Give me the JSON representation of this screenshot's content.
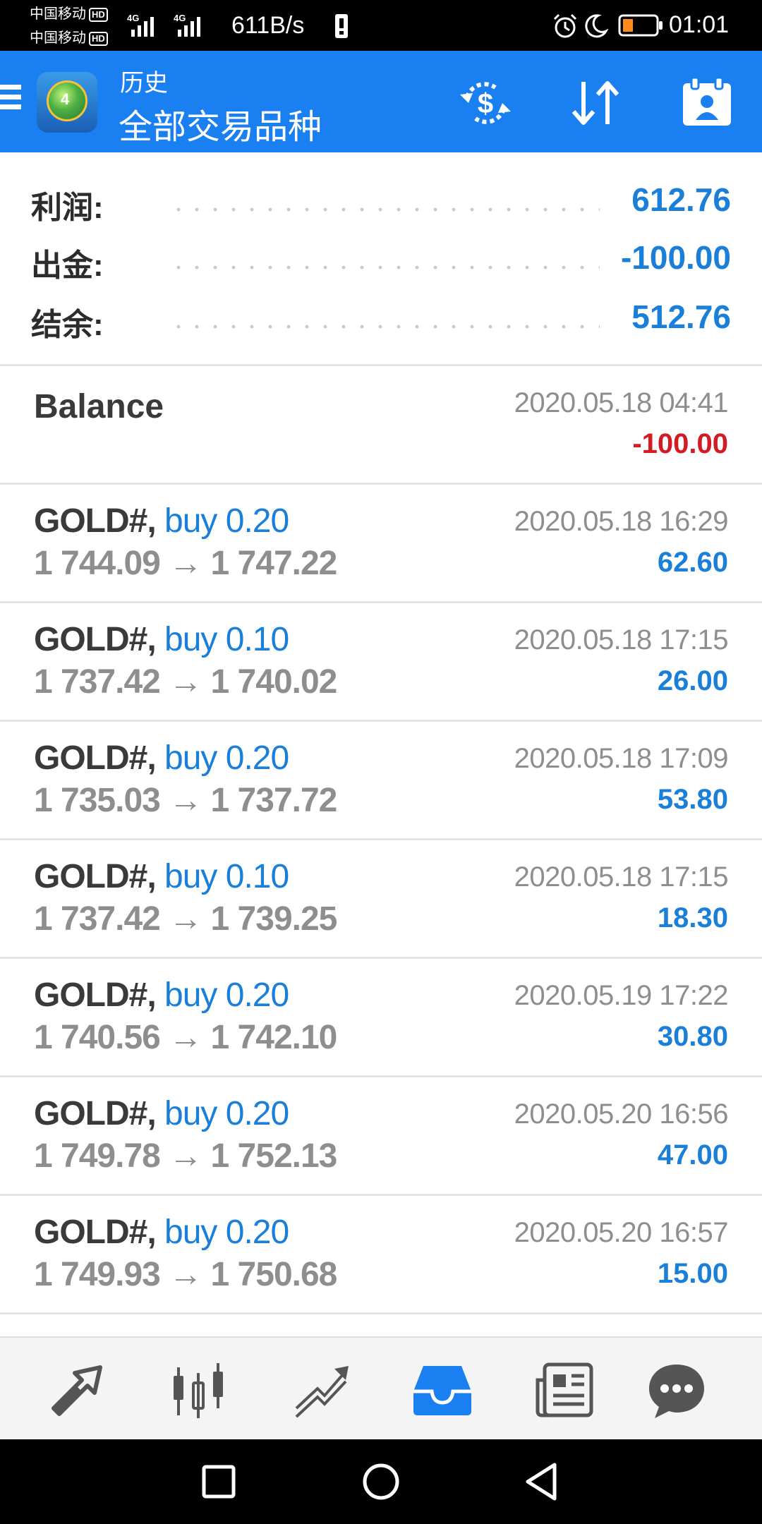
{
  "status_bar": {
    "carrier1": "中国移动",
    "carrier2": "中国移动",
    "hd_label": "HD",
    "net_tag": "4G",
    "net_speed": "611B/s",
    "clock": "01:01",
    "icons": [
      "signal-icon",
      "vibrate-icon",
      "alarm-icon",
      "moon-icon",
      "battery-icon"
    ]
  },
  "app_bar": {
    "subtitle": "历史",
    "title": "全部交易品种",
    "actions": [
      "currency-exchange-icon",
      "sort-icon",
      "account-icon"
    ]
  },
  "summary": [
    {
      "label": "利润:",
      "value": "612.76"
    },
    {
      "label": "出金:",
      "value": "-100.00"
    },
    {
      "label": "结余:",
      "value": "512.76"
    }
  ],
  "balance": {
    "title": "Balance",
    "time": "2020.05.18 04:41",
    "amount": "-100.00"
  },
  "deals": [
    {
      "symbol": "GOLD#,",
      "type": "buy 0.20",
      "prices": "1 744.09 → 1 747.22",
      "time": "2020.05.18 16:29",
      "profit": "62.60"
    },
    {
      "symbol": "GOLD#,",
      "type": "buy 0.10",
      "prices": "1 737.42 → 1 740.02",
      "time": "2020.05.18 17:15",
      "profit": "26.00"
    },
    {
      "symbol": "GOLD#,",
      "type": "buy 0.20",
      "prices": "1 735.03 → 1 737.72",
      "time": "2020.05.18 17:09",
      "profit": "53.80"
    },
    {
      "symbol": "GOLD#,",
      "type": "buy 0.10",
      "prices": "1 737.42 → 1 739.25",
      "time": "2020.05.18 17:15",
      "profit": "18.30"
    },
    {
      "symbol": "GOLD#,",
      "type": "buy 0.20",
      "prices": "1 740.56 → 1 742.10",
      "time": "2020.05.19 17:22",
      "profit": "30.80"
    },
    {
      "symbol": "GOLD#,",
      "type": "buy 0.20",
      "prices": "1 749.78 → 1 752.13",
      "time": "2020.05.20 16:56",
      "profit": "47.00"
    },
    {
      "symbol": "GOLD#,",
      "type": "buy 0.20",
      "prices": "1 749.93 → 1 750.68",
      "time": "2020.05.20 16:57",
      "profit": "15.00"
    }
  ],
  "bottom_nav": [
    {
      "name": "quotes-icon",
      "active": false
    },
    {
      "name": "chart-icon",
      "active": false
    },
    {
      "name": "trade-icon",
      "active": false
    },
    {
      "name": "history-icon",
      "active": true
    },
    {
      "name": "news-icon",
      "active": false
    },
    {
      "name": "chat-icon",
      "active": false
    }
  ],
  "colors": {
    "accent": "#1a7ff0",
    "profit_blue": "#1a7fd9",
    "loss_red": "#d41a22",
    "muted_gray": "#8e8e8e"
  }
}
